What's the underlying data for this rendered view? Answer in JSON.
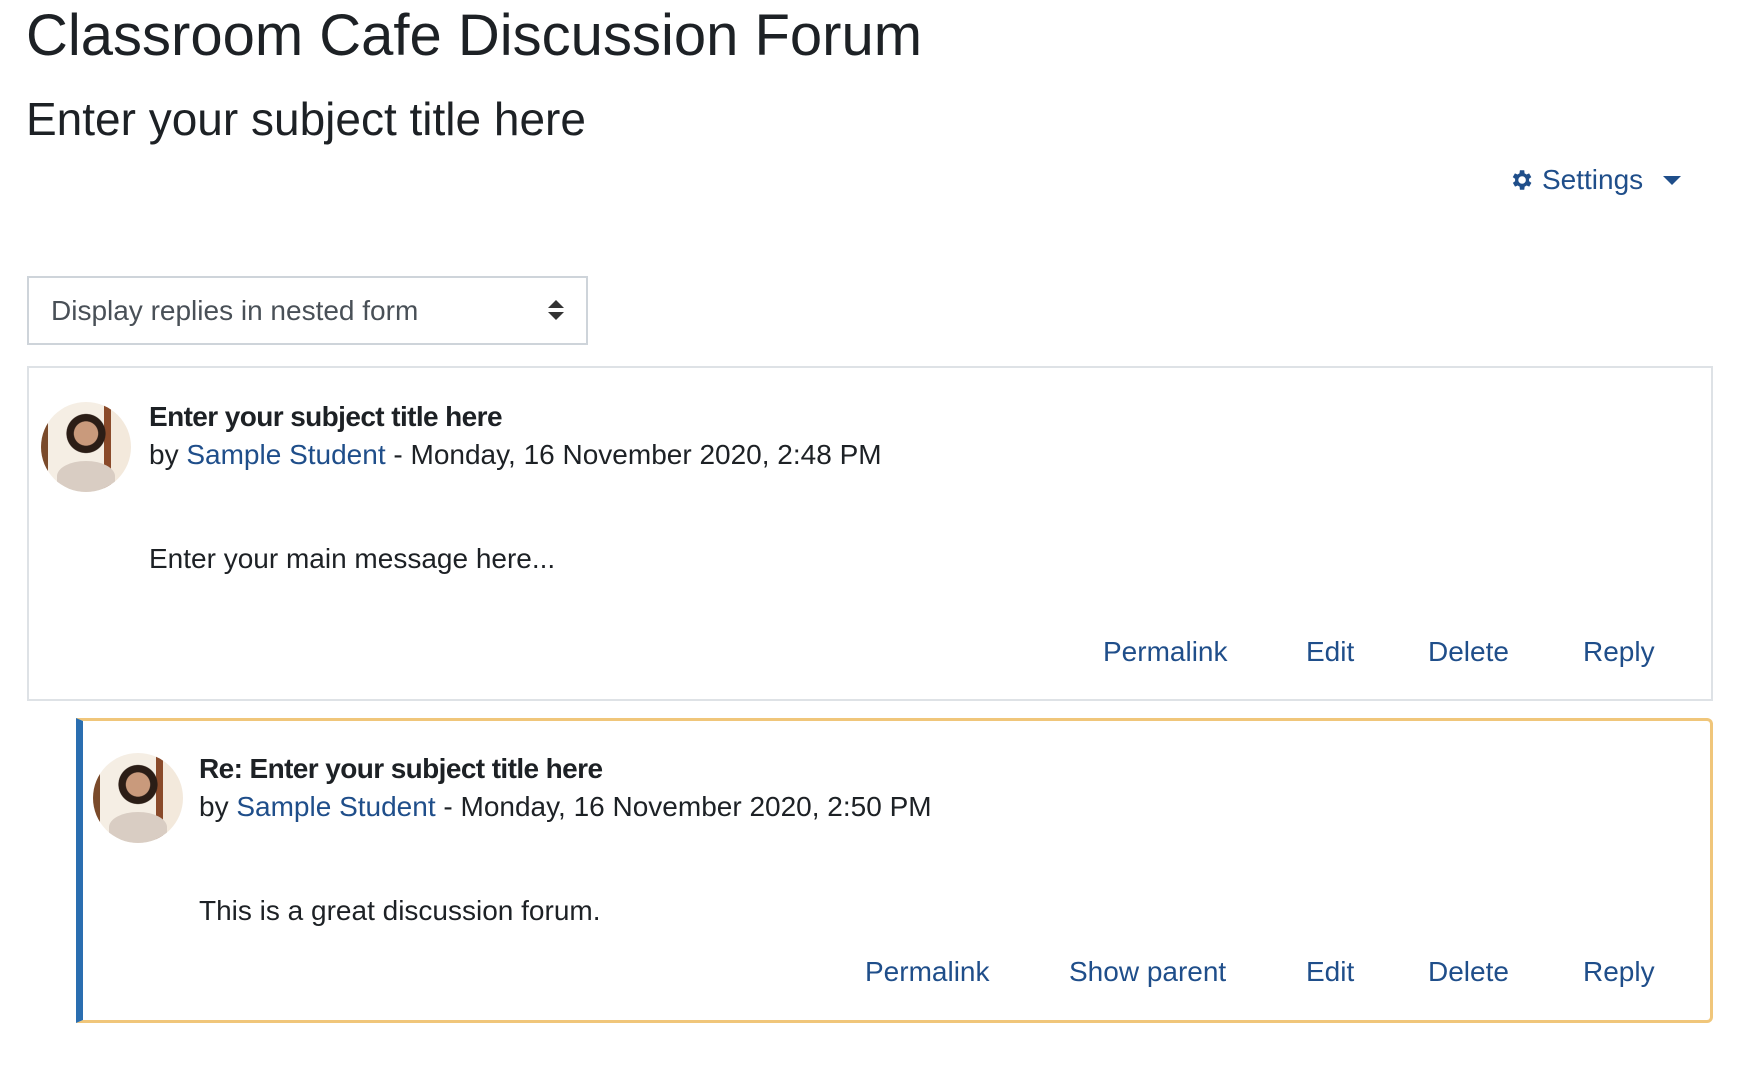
{
  "page": {
    "title": "Classroom Cafe Discussion Forum",
    "subtitle": "Enter your subject title here"
  },
  "settings": {
    "label": "Settings",
    "icon": "gear-icon"
  },
  "display_mode": {
    "selected": "Display replies in nested form"
  },
  "colors": {
    "link": "#1f4e8a",
    "reply_border": "#f0c67a",
    "reply_accent": "#2a6eb0"
  },
  "posts": [
    {
      "subject": "Enter your subject title here",
      "by": "by",
      "author": "Sample Student",
      "date": "- Monday, 16 November 2020, 2:48 PM",
      "message": "Enter your main message here...",
      "actions": [
        "Permalink",
        "Edit",
        "Delete",
        "Reply"
      ]
    },
    {
      "subject": "Re: Enter your subject title here",
      "by": "by",
      "author": "Sample Student",
      "date": "- Monday, 16 November 2020, 2:50 PM",
      "message": "This is a great discussion forum.",
      "actions": [
        "Permalink",
        "Show parent",
        "Edit",
        "Delete",
        "Reply"
      ]
    }
  ]
}
